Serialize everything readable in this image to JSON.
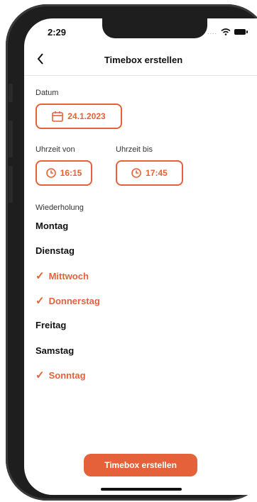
{
  "status_bar": {
    "time": "2:29",
    "signal_dots": "....",
    "icons": [
      "wifi-icon",
      "battery-icon"
    ]
  },
  "nav": {
    "title": "Timebox erstellen",
    "back_icon": "chevron-left-icon"
  },
  "date": {
    "label": "Datum",
    "value": "24.1.2023",
    "icon": "calendar-icon"
  },
  "time_from": {
    "label": "Uhrzeit von",
    "value": "16:15",
    "icon": "clock-icon"
  },
  "time_to": {
    "label": "Uhrzeit bis",
    "value": "17:45",
    "icon": "clock-icon"
  },
  "repeat": {
    "label": "Wiederholung",
    "days": [
      {
        "name": "Montag",
        "selected": false
      },
      {
        "name": "Dienstag",
        "selected": false
      },
      {
        "name": "Mittwoch",
        "selected": true
      },
      {
        "name": "Donnerstag",
        "selected": true
      },
      {
        "name": "Freitag",
        "selected": false
      },
      {
        "name": "Samstag",
        "selected": false
      },
      {
        "name": "Sonntag",
        "selected": true
      }
    ],
    "check_glyph": "✓"
  },
  "submit": {
    "label": "Timebox erstellen"
  },
  "colors": {
    "accent": "#e4613a",
    "text": "#111111"
  }
}
